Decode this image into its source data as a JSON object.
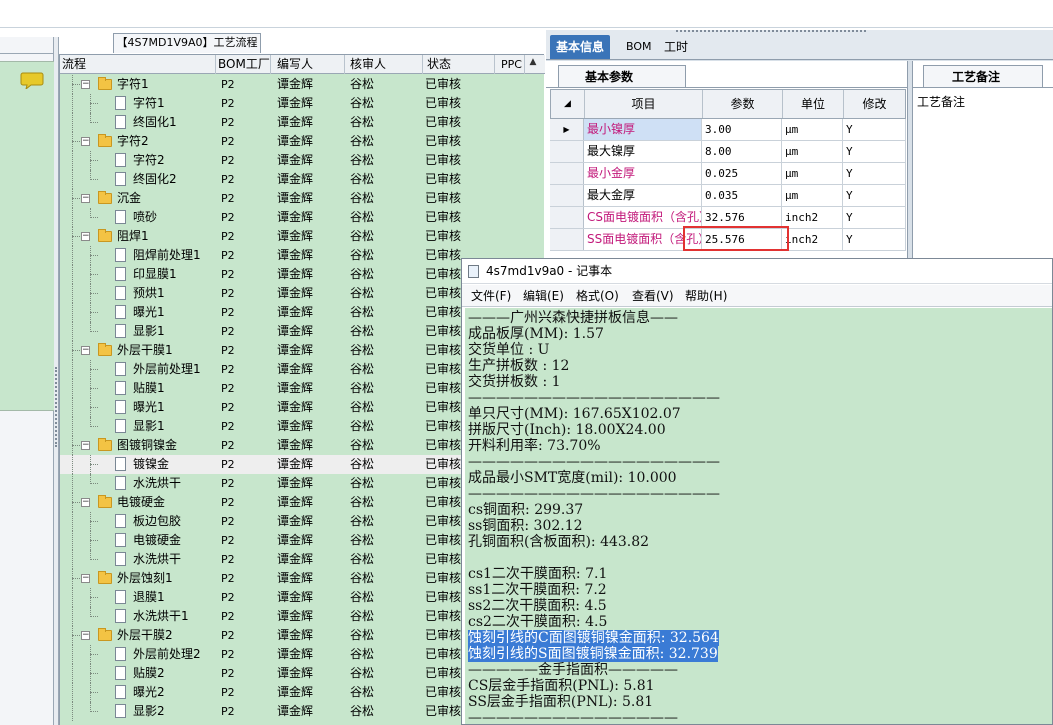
{
  "tree_panel": {
    "title": "【4S7MD1V9A0】工艺流程",
    "headers": {
      "flow": "流程",
      "bom": "BOM工厂",
      "author": "编写人",
      "checker": "核审人",
      "status": "状态",
      "ppc": "PPC"
    },
    "rows": [
      {
        "type": "folder",
        "label": "字符1",
        "bom": "P2",
        "author": "谭金辉",
        "checker": "谷松",
        "status": "已审核"
      },
      {
        "type": "item",
        "label": "字符1",
        "bom": "P2",
        "author": "谭金辉",
        "checker": "谷松",
        "status": "已审核"
      },
      {
        "type": "item",
        "label": "终固化1",
        "bom": "P2",
        "author": "谭金辉",
        "checker": "谷松",
        "status": "已审核"
      },
      {
        "type": "folder",
        "label": "字符2",
        "bom": "P2",
        "author": "谭金辉",
        "checker": "谷松",
        "status": "已审核"
      },
      {
        "type": "item",
        "label": "字符2",
        "bom": "P2",
        "author": "谭金辉",
        "checker": "谷松",
        "status": "已审核"
      },
      {
        "type": "item",
        "label": "终固化2",
        "bom": "P2",
        "author": "谭金辉",
        "checker": "谷松",
        "status": "已审核"
      },
      {
        "type": "folder",
        "label": "沉金",
        "bom": "P2",
        "author": "谭金辉",
        "checker": "谷松",
        "status": "已审核"
      },
      {
        "type": "item",
        "label": "喷砂",
        "bom": "P2",
        "author": "谭金辉",
        "checker": "谷松",
        "status": "已审核"
      },
      {
        "type": "folder",
        "label": "阻焊1",
        "bom": "P2",
        "author": "谭金辉",
        "checker": "谷松",
        "status": "已审核"
      },
      {
        "type": "item",
        "label": "阻焊前处理1",
        "bom": "P2",
        "author": "谭金辉",
        "checker": "谷松",
        "status": "已审核"
      },
      {
        "type": "item",
        "label": "印显膜1",
        "bom": "P2",
        "author": "谭金辉",
        "checker": "谷松",
        "status": "已审核"
      },
      {
        "type": "item",
        "label": "预烘1",
        "bom": "P2",
        "author": "谭金辉",
        "checker": "谷松",
        "status": "已审核"
      },
      {
        "type": "item",
        "label": "曝光1",
        "bom": "P2",
        "author": "谭金辉",
        "checker": "谷松",
        "status": "已审核"
      },
      {
        "type": "item",
        "label": "显影1",
        "bom": "P2",
        "author": "谭金辉",
        "checker": "谷松",
        "status": "已审核"
      },
      {
        "type": "folder",
        "label": "外层干膜1",
        "bom": "P2",
        "author": "谭金辉",
        "checker": "谷松",
        "status": "已审核"
      },
      {
        "type": "item",
        "label": "外层前处理1",
        "bom": "P2",
        "author": "谭金辉",
        "checker": "谷松",
        "status": "已审核"
      },
      {
        "type": "item",
        "label": "贴膜1",
        "bom": "P2",
        "author": "谭金辉",
        "checker": "谷松",
        "status": "已审核"
      },
      {
        "type": "item",
        "label": "曝光1",
        "bom": "P2",
        "author": "谭金辉",
        "checker": "谷松",
        "status": "已审核"
      },
      {
        "type": "item",
        "label": "显影1",
        "bom": "P2",
        "author": "谭金辉",
        "checker": "谷松",
        "status": "已审核"
      },
      {
        "type": "folder",
        "label": "图镀铜镍金",
        "bom": "P2",
        "author": "谭金辉",
        "checker": "谷松",
        "status": "已审核"
      },
      {
        "type": "item",
        "label": "镀镍金",
        "bom": "P2",
        "author": "谭金辉",
        "checker": "谷松",
        "status": "已审核",
        "selected": true
      },
      {
        "type": "item",
        "label": "水洗烘干",
        "bom": "P2",
        "author": "谭金辉",
        "checker": "谷松",
        "status": "已审核"
      },
      {
        "type": "folder",
        "label": "电镀硬金",
        "bom": "P2",
        "author": "谭金辉",
        "checker": "谷松",
        "status": "已审核"
      },
      {
        "type": "item",
        "label": "板边包胶",
        "bom": "P2",
        "author": "谭金辉",
        "checker": "谷松",
        "status": "已审核"
      },
      {
        "type": "item",
        "label": "电镀硬金",
        "bom": "P2",
        "author": "谭金辉",
        "checker": "谷松",
        "status": "已审核"
      },
      {
        "type": "item",
        "label": "水洗烘干",
        "bom": "P2",
        "author": "谭金辉",
        "checker": "谷松",
        "status": "已审核"
      },
      {
        "type": "folder",
        "label": "外层蚀刻1",
        "bom": "P2",
        "author": "谭金辉",
        "checker": "谷松",
        "status": "已审核"
      },
      {
        "type": "item",
        "label": "退膜1",
        "bom": "P2",
        "author": "谭金辉",
        "checker": "谷松",
        "status": "已审核"
      },
      {
        "type": "item",
        "label": "水洗烘干1",
        "bom": "P2",
        "author": "谭金辉",
        "checker": "谷松",
        "status": "已审核"
      },
      {
        "type": "folder",
        "label": "外层干膜2",
        "bom": "P2",
        "author": "谭金辉",
        "checker": "谷松",
        "status": "已审核"
      },
      {
        "type": "item",
        "label": "外层前处理2",
        "bom": "P2",
        "author": "谭金辉",
        "checker": "谷松",
        "status": "已审核"
      },
      {
        "type": "item",
        "label": "贴膜2",
        "bom": "P2",
        "author": "谭金辉",
        "checker": "谷松",
        "status": "已审核"
      },
      {
        "type": "item",
        "label": "曝光2",
        "bom": "P2",
        "author": "谭金辉",
        "checker": "谷松",
        "status": "已审核"
      },
      {
        "type": "item",
        "label": "显影2",
        "bom": "P2",
        "author": "谭金辉",
        "checker": "谷松",
        "status": "已审核"
      }
    ]
  },
  "right_panel": {
    "tabs": [
      "基本信息",
      "BOM",
      "工时"
    ],
    "basic_params_tab": "基本参数",
    "notes_tab": "工艺备注",
    "notes_label": "工艺备注",
    "grid_headers": {
      "item": "项目",
      "param": "参数",
      "unit": "单位",
      "modify": "修改"
    },
    "rows": [
      {
        "name": "最小镍厚",
        "value": "3.00",
        "unit": "μm",
        "modify": "Y",
        "name_color": "#c2187a",
        "current": true
      },
      {
        "name": "最大镍厚",
        "value": "8.00",
        "unit": "μm",
        "modify": "Y",
        "name_color": "#000000"
      },
      {
        "name": "最小金厚",
        "value": "0.025",
        "unit": "μm",
        "modify": "Y",
        "name_color": "#c2187a"
      },
      {
        "name": "最大金厚",
        "value": "0.035",
        "unit": "μm",
        "modify": "Y",
        "name_color": "#000000"
      },
      {
        "name": "CS面电镀面积（含孔）",
        "value": "32.576",
        "unit": "inch2",
        "modify": "Y",
        "name_color": "#c2187a"
      },
      {
        "name": "SS面电镀面积（含孔）",
        "value": "25.576",
        "unit": "inch2",
        "modify": "Y",
        "name_color": "#c2187a"
      }
    ]
  },
  "notepad": {
    "title": "4s7md1v9a0 - 记事本",
    "menu": [
      "文件(F)",
      "编辑(E)",
      "格式(O)",
      "查看(V)",
      "帮助(H)"
    ],
    "lines": [
      {
        "text": "———广州兴森快捷拼板信息——"
      },
      {
        "text": "成品板厚(MM): 1.57"
      },
      {
        "text": "交货单位 : U"
      },
      {
        "text": "生产拼板数 : 12"
      },
      {
        "text": "交货拼板数 : 1"
      },
      {
        "text": "——————————————————"
      },
      {
        "text": "单只尺寸(MM): 167.65X102.07"
      },
      {
        "text": "拼版尺寸(Inch): 18.00X24.00"
      },
      {
        "text": "开料利用率: 73.70%"
      },
      {
        "text": "——————————————————"
      },
      {
        "text": "成品最小SMT宽度(mil): 10.000"
      },
      {
        "text": "——————————————————"
      },
      {
        "text": "cs铜面积: 299.37"
      },
      {
        "text": "ss铜面积: 302.12"
      },
      {
        "text": "孔铜面积(含板面积): 443.82"
      },
      {
        "text": ""
      },
      {
        "text": "cs1二次干膜面积: 7.1"
      },
      {
        "text": "ss1二次干膜面积: 7.2"
      },
      {
        "text": "ss2二次干膜面积: 4.5"
      },
      {
        "text": "cs2二次干膜面积: 4.5"
      },
      {
        "text": "蚀刻引线的C面图镀铜镍金面积: 32.564",
        "highlight": true
      },
      {
        "text": "蚀刻引线的S面图镀铜镍金面积: 32.739",
        "highlight": true
      },
      {
        "text": "—————金手指面积—————"
      },
      {
        "text": "CS层金手指面积(PNL): 5.81"
      },
      {
        "text": "SS层金手指面积(PNL): 5.81"
      },
      {
        "text": "———————————————"
      }
    ]
  },
  "colors": {
    "panel_green": "#c7e6cc",
    "tab_active_blue": "#3a74b8",
    "highlight_blue": "#3a7bd5",
    "annotation_red": "#e23232",
    "param_magenta": "#c2187a"
  }
}
